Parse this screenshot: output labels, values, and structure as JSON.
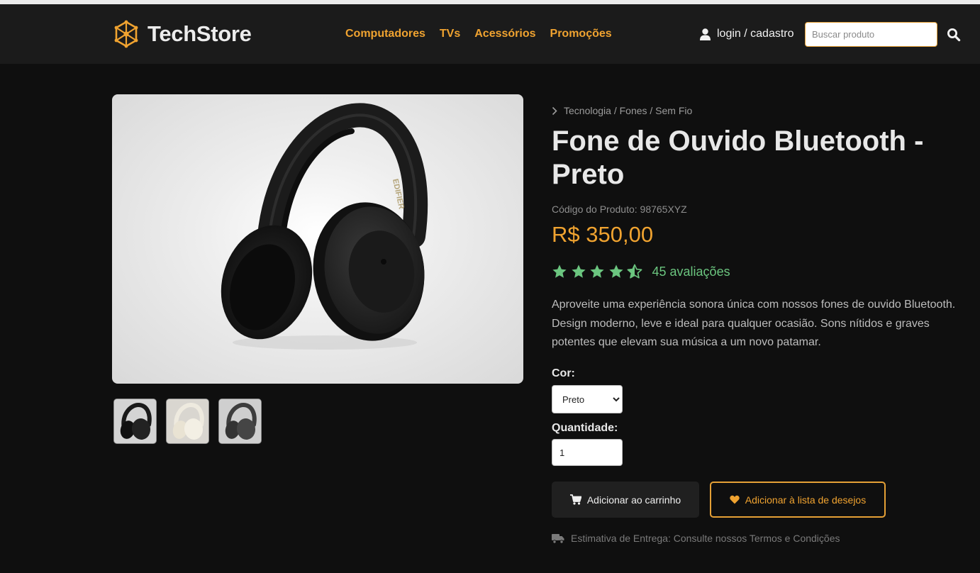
{
  "brand": {
    "name": "TechStore",
    "accent": "#f0a330"
  },
  "nav": {
    "items": [
      {
        "label": "Computadores"
      },
      {
        "label": "TVs"
      },
      {
        "label": "Acessórios"
      },
      {
        "label": "Promoções"
      }
    ],
    "login_label": "login / cadastro",
    "search_placeholder": "Buscar produto",
    "search_value": ""
  },
  "product": {
    "breadcrumb": "Tecnologia / Fones / Sem Fio",
    "title": "Fone de Ouvido Bluetooth - Preto",
    "code": "Código do Produto: 98765XYZ",
    "price": "R$ 350,00",
    "rating": {
      "stars": 4.5,
      "max_stars": 5,
      "count_label": "45 avaliações",
      "color": "#6bc57f"
    },
    "description": "Aproveite uma experiência sonora única com nossos fones de ouvido Bluetooth. Design moderno, leve e ideal para qualquer ocasião. Sons nítidos e graves potentes que elevam sua música a um novo patamar.",
    "image_brand_text": "EDIFIER",
    "thumbnails": [
      {
        "variant": "black-headphones-icon"
      },
      {
        "variant": "cream-headphones-icon"
      },
      {
        "variant": "gray-headphones-icon"
      }
    ],
    "color_label": "Cor:",
    "color_selected": "Preto",
    "quantity_label": "Quantidade:",
    "quantity_value": "1",
    "add_to_cart_label": "Adicionar ao carrinho",
    "wishlist_label": "Adicionar à lista de desejos",
    "delivery_text": "Estimativa de Entrega: Consulte nossos Termos e Condições"
  }
}
